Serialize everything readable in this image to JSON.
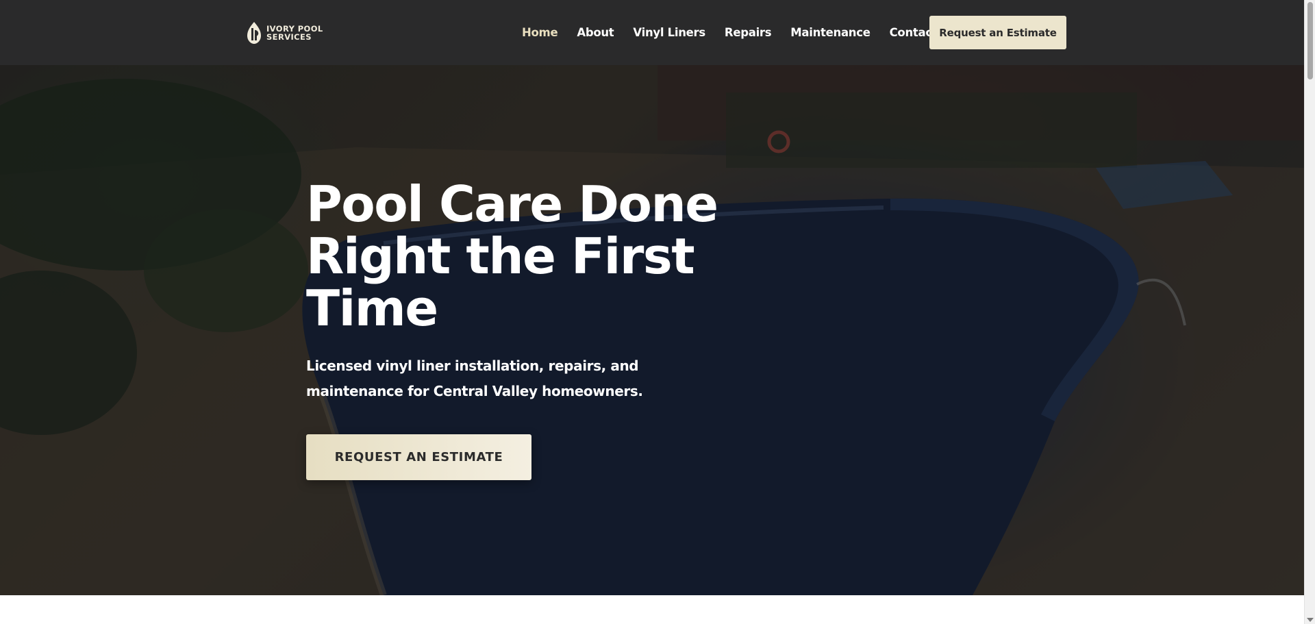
{
  "header": {
    "logo_text_line1": "IVORY POOL",
    "logo_text_line2": "SERVICES",
    "nav": [
      {
        "label": "Home"
      },
      {
        "label": "About"
      },
      {
        "label": "Vinyl Liners"
      },
      {
        "label": "Repairs"
      },
      {
        "label": "Maintenance"
      },
      {
        "label": "Contact"
      }
    ],
    "cta_label": "Request an Estimate"
  },
  "hero": {
    "title": "Pool Care Done Right the First Time",
    "subtitle": "Licensed vinyl liner installation, repairs, and maintenance for Central Valley homeowners.",
    "cta_label": "REQUEST AN ESTIMATE"
  },
  "colors": {
    "header_bg": "#2a2a2b",
    "accent_ivory": "#ece5cd",
    "active_nav": "#e9dfbf"
  }
}
